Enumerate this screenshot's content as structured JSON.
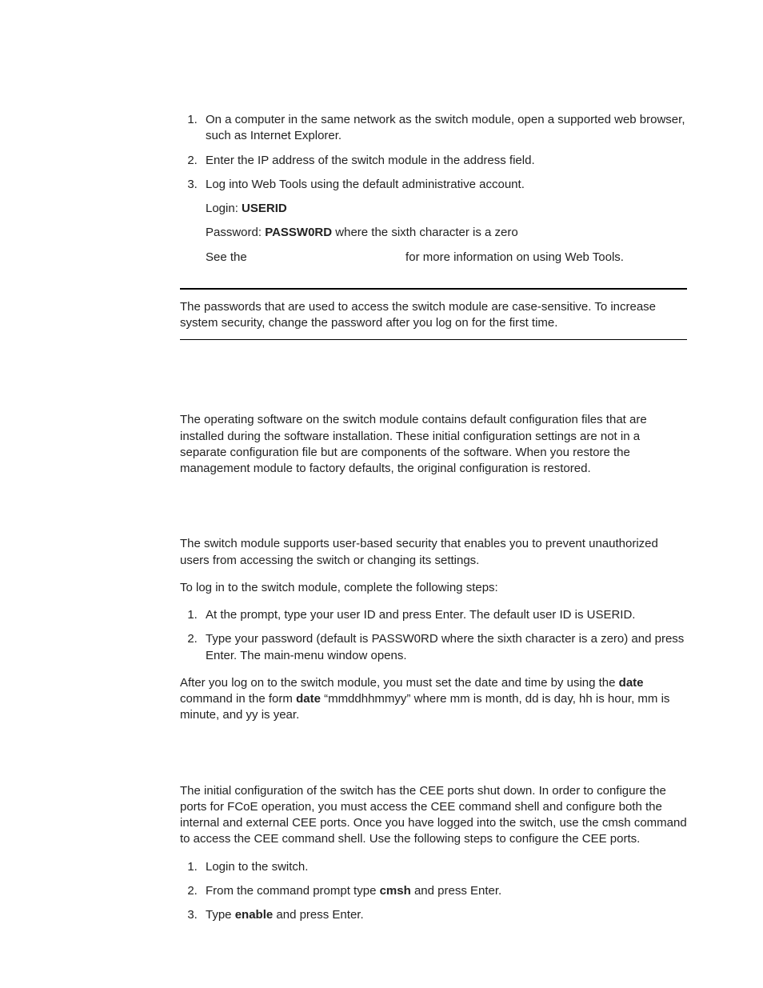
{
  "list1": {
    "items": [
      "On a computer in the same network as the switch module, open a supported web browser, such as Internet Explorer.",
      "Enter the IP address of the switch module in the address field.",
      "Log into Web Tools using the default administrative account."
    ],
    "login_intro": "Login: ",
    "login_value": "USERID",
    "password_intro": "Password: ",
    "password_value": "PASSW0RD",
    "password_tail": " where the sixth character is a zero",
    "see_lead": "See the ",
    "see_tail": " for more information on using Web Tools."
  },
  "note_body": "The passwords that are used to access the switch module are case-sensitive. To increase system security, change the password after you log on for the first time.",
  "section_defaults": "The operating software on the switch module contains default configuration files that are installed during the software installation. These initial configuration settings are not in a separate configuration file but are components of the software. When you restore the management module to factory defaults, the original configuration is restored.",
  "security_intro": "The switch module supports user-based security that enables you to prevent unauthorized users from accessing the switch or changing its settings.",
  "login_steps_lead": "To log in to the switch module, complete the following steps:",
  "list2": {
    "items": [
      "At the prompt, type your user ID and press Enter. The default user ID is USERID.",
      "Type your password (default is PASSW0RD where the sixth character is a zero) and press Enter. The main-menu window opens."
    ]
  },
  "date_para": {
    "lead": "After you log on to the switch module, you must set the date and time by using the ",
    "cmd1": "date",
    "mid": " command in the form ",
    "cmd2": "date",
    "tail": " “mmddhhmmyy” where mm is month, dd is day, hh is hour, mm is minute, and yy is year."
  },
  "cee_intro": "The initial configuration of the switch has the CEE ports shut down. In order to configure the ports for FCoE operation, you must access the CEE command shell and configure both the internal and external CEE ports. Once you have logged into the switch, use the cmsh command to access the CEE command shell. Use the following steps to configure the CEE ports.",
  "list3": {
    "item1": "Login to the switch.",
    "item2_lead": "From the command prompt type ",
    "item2_cmd": "cmsh",
    "item2_tail": " and press Enter.",
    "item3_lead": "Type ",
    "item3_cmd": "enable",
    "item3_tail": " and press Enter."
  }
}
